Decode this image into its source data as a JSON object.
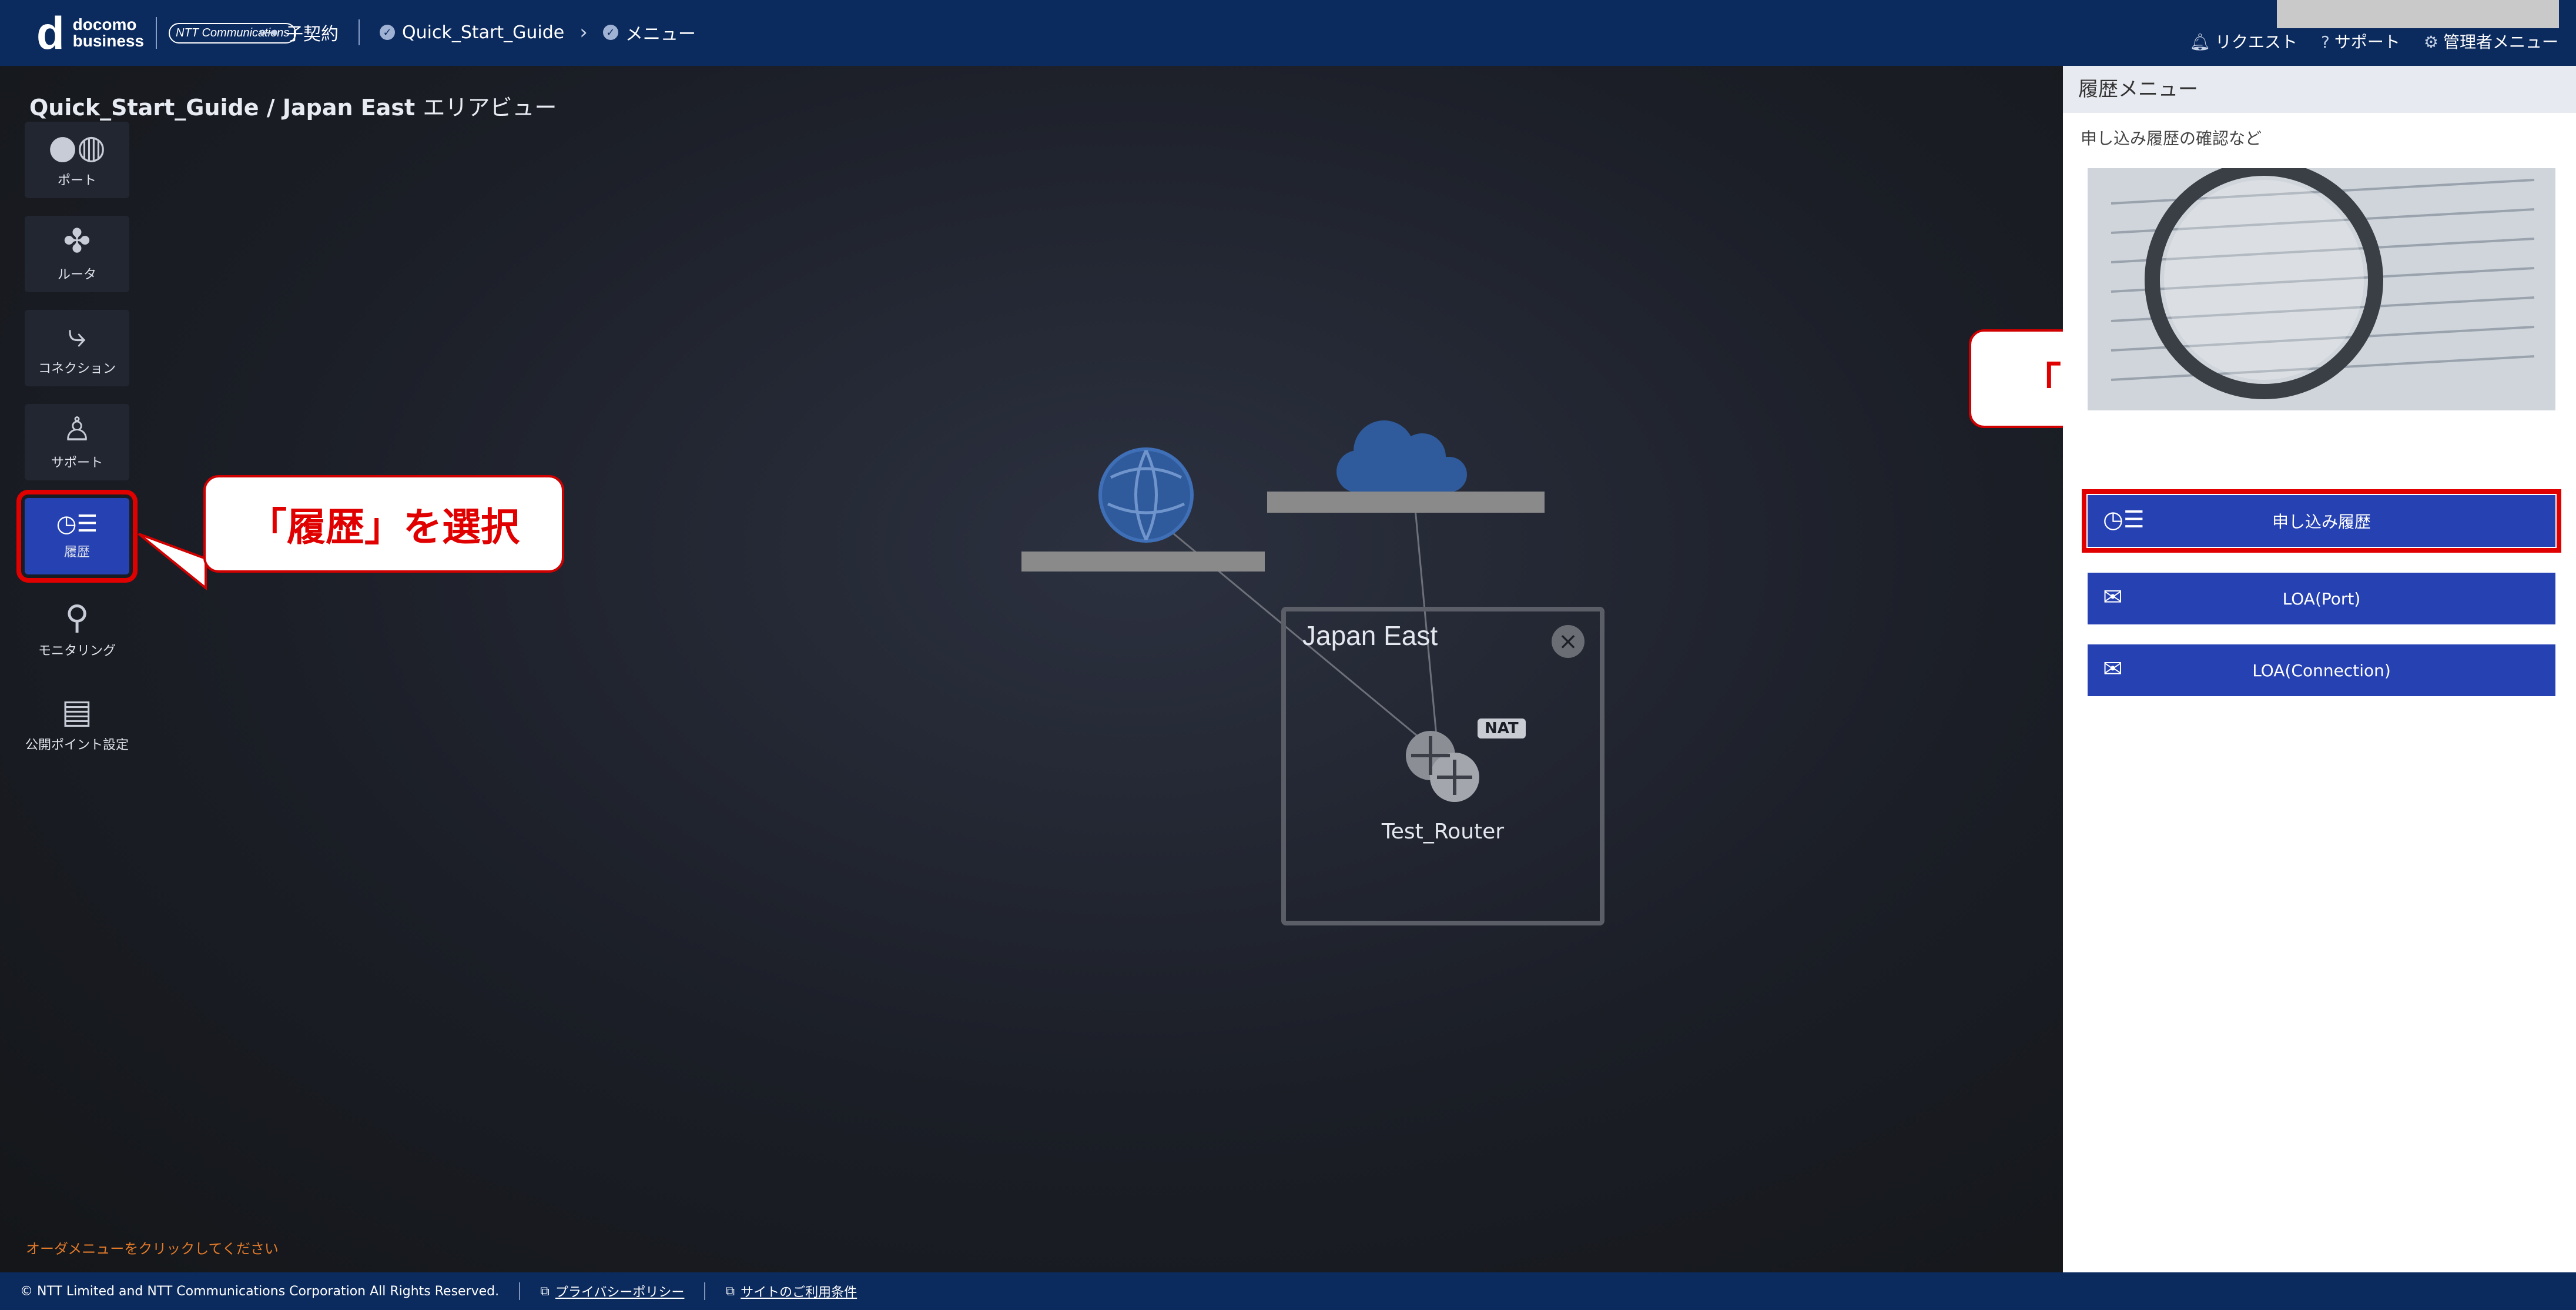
{
  "header": {
    "logo_main": "d",
    "logo_word1": "docomo",
    "logo_word2": "business",
    "logo_ntt": "NTT Communications",
    "breadcrumbs": [
      {
        "label": "子契約"
      },
      {
        "label": "Quick_Start_Guide"
      },
      {
        "label": "メニュー"
      }
    ],
    "links": [
      {
        "label": "リクエスト",
        "icon": "bell-icon"
      },
      {
        "label": "サポート",
        "icon": "help-icon"
      },
      {
        "label": "管理者メニュー",
        "icon": "gear-icon"
      }
    ]
  },
  "canvas": {
    "title_bold": "Quick_Start_Guide / Japan East",
    "title_light": "エリアビュー",
    "sidebar": [
      {
        "label": "ポート",
        "icon": "port-icon"
      },
      {
        "label": "ルータ",
        "icon": "router-icon"
      },
      {
        "label": "コネクション",
        "icon": "connection-icon"
      },
      {
        "label": "サポート",
        "icon": "support-icon"
      },
      {
        "label": "履歴",
        "icon": "history-icon",
        "active": true
      },
      {
        "label": "モニタリング",
        "icon": "monitoring-icon"
      },
      {
        "label": "公開ポイント設定",
        "icon": "public-point-icon"
      }
    ],
    "area": {
      "name": "Japan East",
      "router_name": "Test_Router",
      "router_badge": "NAT"
    },
    "hint": "オーダメニューをクリックしてください"
  },
  "callouts": {
    "left": "「履歴」を選択",
    "right": "「申し込み履歴」を選択"
  },
  "right_panel": {
    "title": "履歴メニュー",
    "subtitle": "申し込み履歴の確認など",
    "buttons": [
      {
        "label": "申し込み履歴",
        "icon": "history-icon",
        "selected": true
      },
      {
        "label": "LOA(Port)",
        "icon": "envelope-icon"
      },
      {
        "label": "LOA(Connection)",
        "icon": "envelope-icon"
      }
    ]
  },
  "footer": {
    "copyright": "© NTT Limited and NTT Communications Corporation All Rights Reserved.",
    "privacy": "プライバシーポリシー",
    "terms": "サイトのご利用条件"
  },
  "colors": {
    "header_bg": "#0b2a5e",
    "accent_blue": "#2541b2",
    "highlight_red": "#e10000",
    "hint_orange": "#e27a2a"
  }
}
